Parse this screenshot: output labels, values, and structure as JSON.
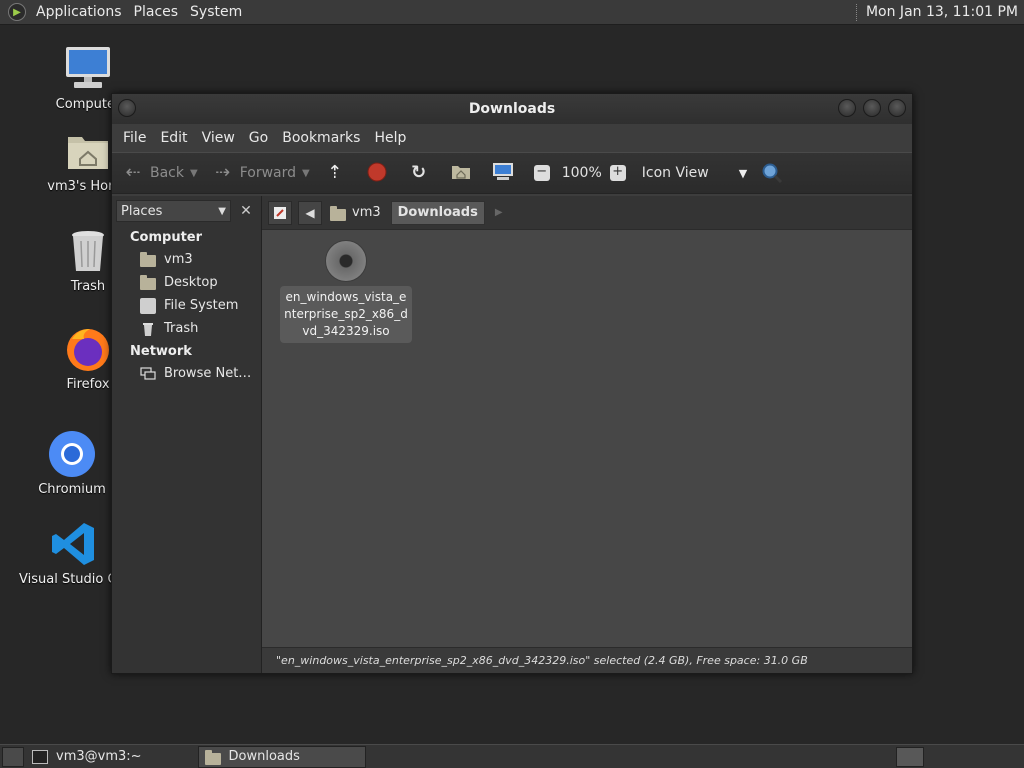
{
  "top_panel": {
    "menus": [
      "Applications",
      "Places",
      "System"
    ],
    "clock": "Mon Jan 13, 11:01 PM"
  },
  "desktop": {
    "icons": [
      {
        "label": "Computer",
        "icon": "computer-icon"
      },
      {
        "label": "vm3's Home",
        "icon": "home-folder-icon"
      },
      {
        "label": "Trash",
        "icon": "trash-icon"
      },
      {
        "label": "Firefox",
        "icon": "firefox-icon"
      },
      {
        "label": "Chromium",
        "icon": "chromium-icon"
      },
      {
        "label": "Visual Studio Code",
        "icon": "vscode-icon"
      }
    ]
  },
  "window": {
    "title": "Downloads",
    "menu": [
      "File",
      "Edit",
      "View",
      "Go",
      "Bookmarks",
      "Help"
    ],
    "toolbar": {
      "back": "Back",
      "forward": "Forward",
      "zoom": "100%",
      "view_mode": "Icon View"
    },
    "sidebar": {
      "selector": "Places",
      "sections": [
        {
          "title": "Computer",
          "items": [
            "vm3",
            "Desktop",
            "File System",
            "Trash"
          ]
        },
        {
          "title": "Network",
          "items": [
            "Browse Net…"
          ]
        }
      ]
    },
    "breadcrumb": [
      "vm3",
      "Downloads"
    ],
    "files": [
      {
        "name": "en_windows_vista_enterprise_sp2_x86_dvd_342329.iso",
        "icon": "disc-image-icon"
      }
    ],
    "status": "\"en_windows_vista_enterprise_sp2_x86_dvd_342329.iso\" selected (2.4 GB), Free space: 31.0 GB"
  },
  "taskbar": {
    "tasks": [
      {
        "label": "vm3@vm3:~",
        "icon": "terminal-icon"
      },
      {
        "label": "Downloads",
        "icon": "folder-icon"
      }
    ]
  },
  "colors": {
    "panel": "#3a3a3a",
    "desktop": "#272727",
    "window_bg": "#3d3d3d",
    "file_area": "#474747",
    "stop_red": "#c0392b"
  }
}
